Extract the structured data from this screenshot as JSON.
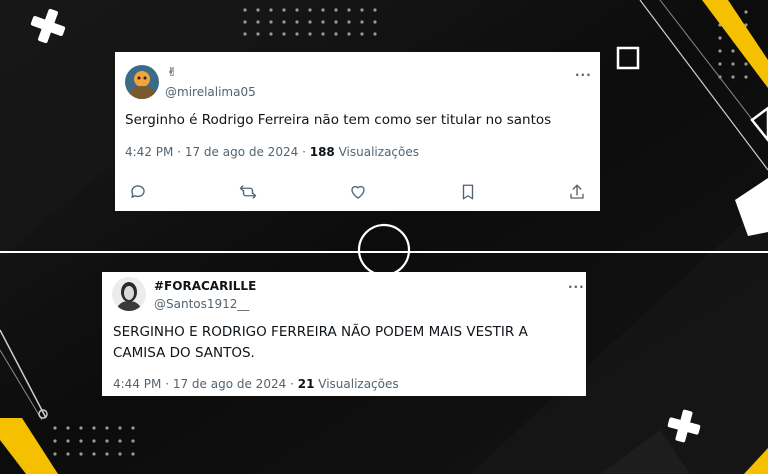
{
  "tweets": [
    {
      "display_name": "✌",
      "handle": "@mirelalima05",
      "text": "Serginho  é  Rodrigo Ferreira  não tem como ser titular no santos",
      "time": "4:42 PM",
      "date": "17 de ago de 2024",
      "views_count": "188",
      "views_label": "Visualizações",
      "more_label": "···",
      "separator": "·"
    },
    {
      "display_name": "#FORACARILLE",
      "handle": "@Santos1912__",
      "text": "SERGINHO E RODRIGO FERREIRA NÃO PODEM MAIS VESTIR A CAMISA DO SANTOS.",
      "time": "4:44 PM",
      "date": "17 de ago de 2024",
      "views_count": "21",
      "views_label": "Visualizações",
      "more_label": "···",
      "separator": "·"
    }
  ],
  "actions": [
    "reply-icon",
    "retweet-icon",
    "like-icon",
    "bookmark-icon",
    "share-icon"
  ],
  "colors": {
    "accent": "#f5c000",
    "background": "#0a0a0a",
    "card": "#ffffff",
    "text": "#0f1419",
    "muted": "#536471"
  }
}
